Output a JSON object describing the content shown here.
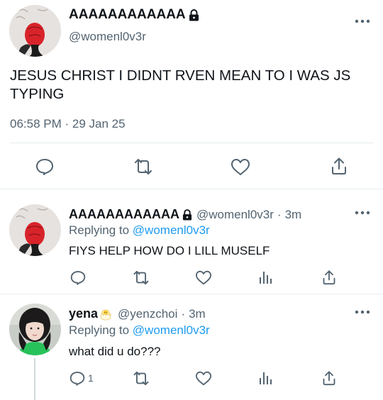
{
  "main_tweet": {
    "display_name": "AAAAAAAAAAAA",
    "handle": "@womenl0v3r",
    "text": "JESUS CHRIST I DIDNT RVEN MEAN TO I WAS JS TYPING",
    "time": "06:58 PM",
    "separator": "·",
    "date": "29 Jan 25"
  },
  "reply1": {
    "display_name": "AAAAAAAAAAAA",
    "handle": "@womenl0v3r",
    "separator": "·",
    "age": "3m",
    "replying_label": "Replying to",
    "replying_to": "@womenl0v3r",
    "text": "FIYS HELP HOW DO I LILL MUSELF"
  },
  "reply2": {
    "display_name": "yena",
    "handle": "@yenzchoi",
    "separator": "·",
    "age": "3m",
    "replying_label": "Replying to",
    "replying_to": "@womenl0v3r",
    "text": "what did u do???",
    "reply_count": "1"
  },
  "colors": {
    "text": "#0f1419",
    "secondary": "#536471",
    "link": "#1d9bf0",
    "divider": "#e6ecf0"
  },
  "icons": [
    "lock-icon",
    "more-icon",
    "reply-icon",
    "retweet-icon",
    "like-icon",
    "share-icon",
    "analytics-icon",
    "chick-emoji-icon"
  ]
}
